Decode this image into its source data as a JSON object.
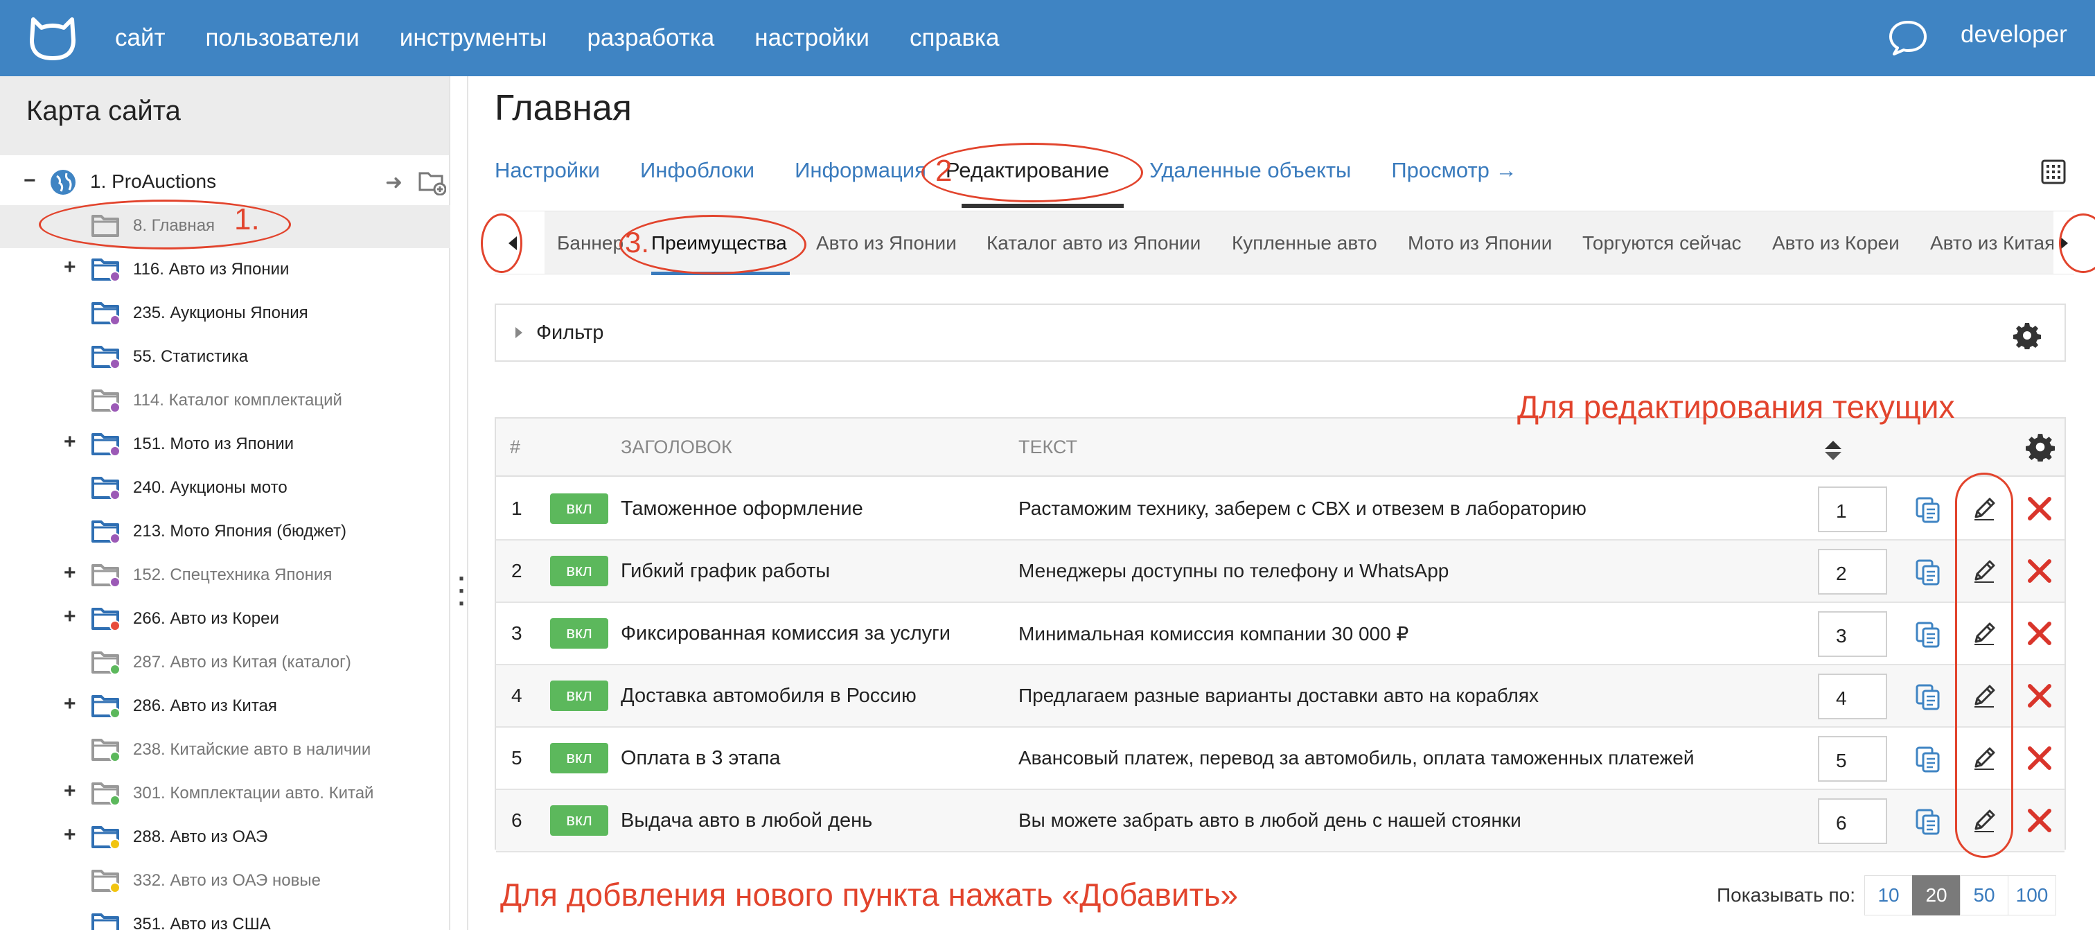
{
  "topbar": {
    "nav": [
      "сайт",
      "пользователи",
      "инструменты",
      "разработка",
      "настройки",
      "справка"
    ],
    "user": "developer"
  },
  "sidebar": {
    "title": "Карта сайта",
    "root": "1. ProAuctions",
    "items": [
      {
        "label": "8. Главная",
        "expand": "",
        "dim": true,
        "dot": ""
      },
      {
        "label": "116. Авто из Японии",
        "expand": "+",
        "dim": false,
        "dot": "#9b59b6"
      },
      {
        "label": "235. Аукционы Япония",
        "expand": "",
        "dim": false,
        "dot": "#9b59b6"
      },
      {
        "label": "55. Статистика",
        "expand": "",
        "dim": false,
        "dot": "#9b59b6"
      },
      {
        "label": "114. Каталог комплектаций",
        "expand": "",
        "dim": true,
        "dot": "#9b59b6"
      },
      {
        "label": "151. Мото из Японии",
        "expand": "+",
        "dim": false,
        "dot": "#9b59b6"
      },
      {
        "label": "240. Аукционы мото",
        "expand": "",
        "dim": false,
        "dot": "#9b59b6"
      },
      {
        "label": "213. Мото Япония (бюджет)",
        "expand": "",
        "dim": false,
        "dot": "#9b59b6"
      },
      {
        "label": "152. Спецтехника Япония",
        "expand": "+",
        "dim": true,
        "dot": "#9b59b6"
      },
      {
        "label": "266. Авто из Кореи",
        "expand": "+",
        "dim": false,
        "dot": "#e74c3c"
      },
      {
        "label": "287. Авто из Китая (каталог)",
        "expand": "",
        "dim": true,
        "dot": "#5cb85c"
      },
      {
        "label": "286. Авто из Китая",
        "expand": "+",
        "dim": false,
        "dot": "#5cb85c"
      },
      {
        "label": "238. Китайские авто в наличии",
        "expand": "",
        "dim": true,
        "dot": "#5cb85c"
      },
      {
        "label": "301. Комплектации авто. Китай",
        "expand": "+",
        "dim": true,
        "dot": "#5cb85c"
      },
      {
        "label": "288. Авто из ОАЭ",
        "expand": "+",
        "dim": false,
        "dot": "#f1c40f"
      },
      {
        "label": "332. Авто из ОАЭ новые",
        "expand": "",
        "dim": true,
        "dot": "#f1c40f"
      },
      {
        "label": "351. Авто из США",
        "expand": "",
        "dim": false,
        "dot": ""
      }
    ]
  },
  "main": {
    "title": "Главная",
    "tabs": [
      "Настройки",
      "Инфоблоки",
      "Информация",
      "Редактирование",
      "Удаленные объекты",
      "Просмотр →"
    ],
    "subtabs": [
      "Баннер",
      "Преимущества",
      "Авто из Японии",
      "Каталог авто из Японии",
      "Купленные авто",
      "Мото из Японии",
      "Торгуются сейчас",
      "Авто из Кореи",
      "Авто из Китая"
    ],
    "filter": "Фильтр",
    "table": {
      "headers": [
        "#",
        "ЗАГОЛОВОК",
        "ТЕКСТ"
      ],
      "rows": [
        {
          "n": "1",
          "badge": "вкл",
          "title": "Таможенное оформление",
          "text": "Растаможим технику, заберем с СВХ и отвезем в лабораторию",
          "order": "1"
        },
        {
          "n": "2",
          "badge": "вкл",
          "title": "Гибкий график работы",
          "text": "Менеджеры доступны по телефону и WhatsApp",
          "order": "2"
        },
        {
          "n": "3",
          "badge": "вкл",
          "title": "Фиксированная комиссия за услуги",
          "text": "Минимальная комиссия компании 30 000 ₽",
          "order": "3"
        },
        {
          "n": "4",
          "badge": "вкл",
          "title": "Доставка автомобиля в Россию",
          "text": "Предлагаем разные варианты доставки авто на кораблях",
          "order": "4"
        },
        {
          "n": "5",
          "badge": "вкл",
          "title": "Оплата в 3 этапа",
          "text": "Авансовый платеж, перевод за автомобиль, оплата таможенных платежей",
          "order": "5"
        },
        {
          "n": "6",
          "badge": "вкл",
          "title": "Выдача авто в любой день",
          "text": "Вы можете забрать авто в любой день с нашей стоянки",
          "order": "6"
        }
      ]
    },
    "pager": {
      "label": "Показывать по:",
      "options": [
        "10",
        "20",
        "50",
        "100"
      ],
      "selected": "20"
    }
  },
  "annotations": {
    "step1": "1.",
    "step2": "2",
    "step3": "3.",
    "edit_note": "Для редактирования текущих",
    "add_note": "Для добвления нового пункта нажать «Добавить»"
  }
}
